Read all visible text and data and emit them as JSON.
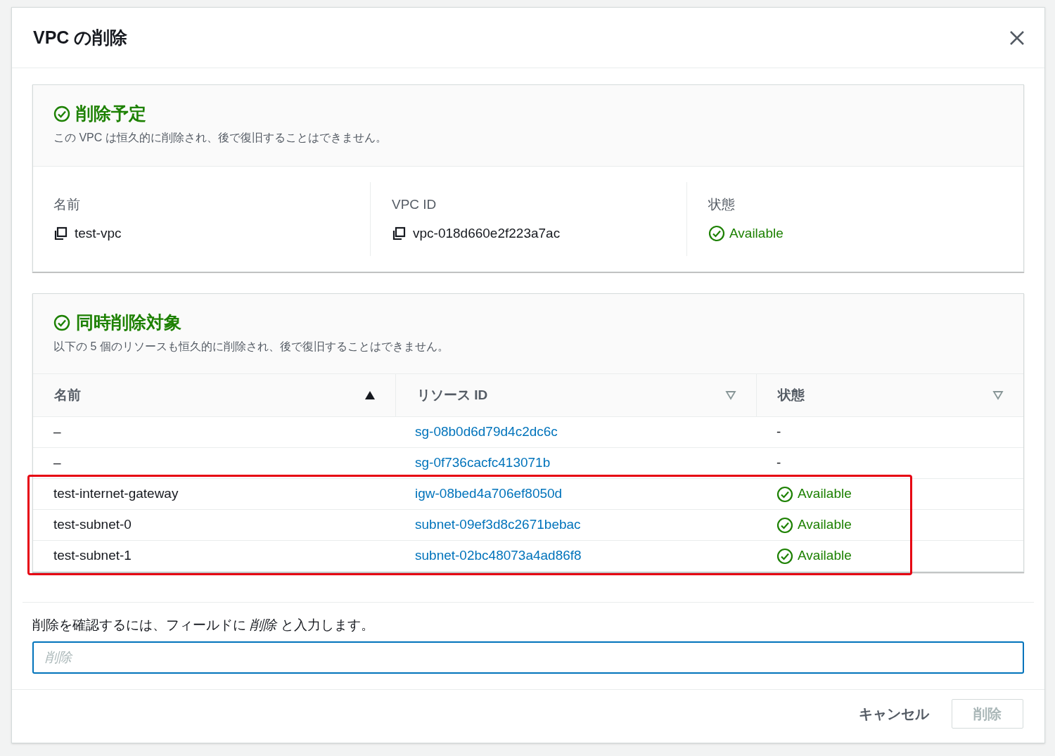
{
  "dialog": {
    "title": "VPC の削除"
  },
  "scheduled": {
    "heading": "削除予定",
    "description": "この VPC は恒久的に削除され、後で復旧することはできません。",
    "fields": [
      {
        "label": "名前",
        "kind": "copy",
        "value": "test-vpc"
      },
      {
        "label": "VPC ID",
        "kind": "copy",
        "value": "vpc-018d660e2f223a7ac"
      },
      {
        "label": "状態",
        "kind": "status",
        "value": "Available"
      }
    ]
  },
  "also_deleted": {
    "heading": "同時削除対象",
    "description": "以下の 5 個のリソースも恒久的に削除され、後で復旧することはできません。",
    "columns": [
      {
        "label": "名前",
        "sorted": true
      },
      {
        "label": "リソース ID",
        "sorted": false
      },
      {
        "label": "状態",
        "sorted": false
      }
    ],
    "rows": [
      {
        "name": "–",
        "resource_id": "sg-08b0d6d79d4c2dc6c",
        "status": {
          "kind": "none",
          "text": "-"
        },
        "highlighted": false
      },
      {
        "name": "–",
        "resource_id": "sg-0f736cacfc413071b",
        "status": {
          "kind": "none",
          "text": "-"
        },
        "highlighted": false
      },
      {
        "name": "test-internet-gateway",
        "resource_id": "igw-08bed4a706ef8050d",
        "status": {
          "kind": "available",
          "text": "Available"
        },
        "highlighted": true
      },
      {
        "name": "test-subnet-0",
        "resource_id": "subnet-09ef3d8c2671bebac",
        "status": {
          "kind": "available",
          "text": "Available"
        },
        "highlighted": true
      },
      {
        "name": "test-subnet-1",
        "resource_id": "subnet-02bc48073a4ad86f8",
        "status": {
          "kind": "available",
          "text": "Available"
        },
        "highlighted": true
      }
    ]
  },
  "confirm": {
    "label": "削除を確認するには、フィールドに *削除* と入力します。",
    "placeholder": "削除"
  },
  "buttons": [
    {
      "label": "キャンセル",
      "kind": "link",
      "disabled": false
    },
    {
      "label": "削除",
      "kind": "primary",
      "disabled": true
    }
  ]
}
